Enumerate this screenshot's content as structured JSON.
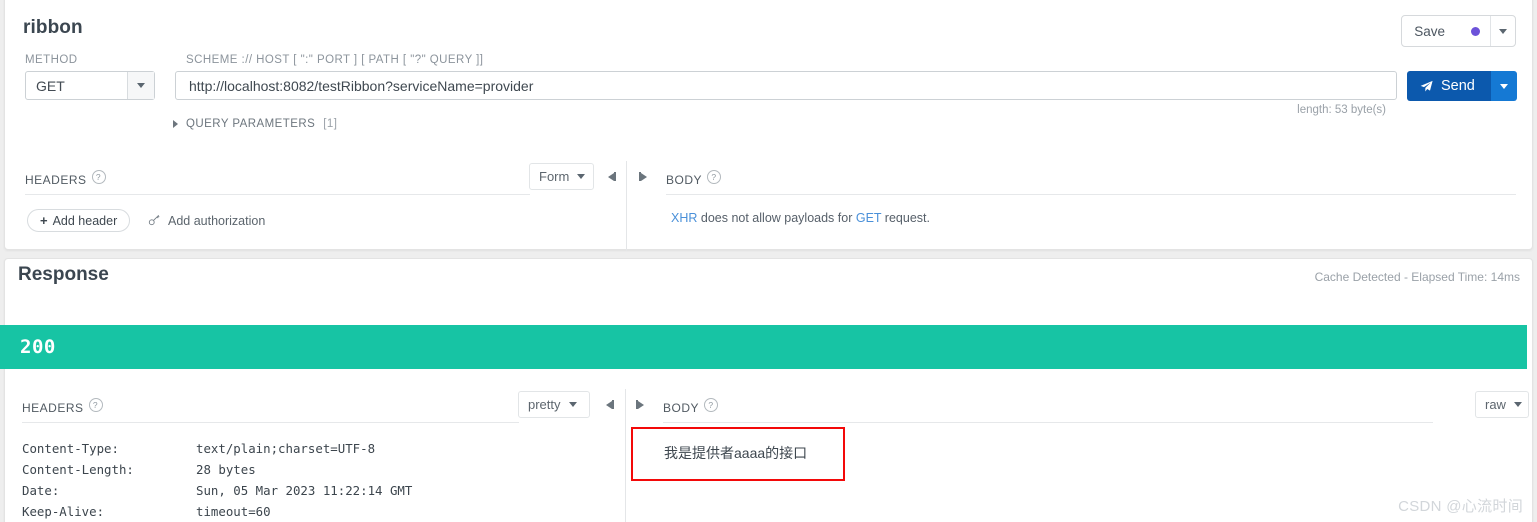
{
  "request": {
    "title": "ribbon",
    "save": {
      "label": "Save",
      "dot_color": "#6c52d9",
      "caret": "caret-down-icon"
    },
    "method": {
      "label": "METHOD",
      "value": "GET"
    },
    "url": {
      "label": "SCHEME :// HOST [ \":\" PORT ] [ PATH [ \"?\" QUERY ]]",
      "value": "http://localhost:8082/testRibbon?serviceName=provider"
    },
    "send": {
      "label": "Send",
      "icon": "paper-plane-icon",
      "color": "#0c59ad",
      "caret_color": "#1579d4"
    },
    "length_note": "length: 53 byte(s)",
    "query_parameters": {
      "label": "QUERY PARAMETERS",
      "count": "[1]"
    },
    "headers_panel": {
      "title": "HEADERS",
      "help": "?",
      "view_mode": "Form",
      "add_header_label": "Add header",
      "add_header_icon": "plus-icon",
      "add_authorization_label": "Add authorization",
      "add_authorization_icon": "key-icon"
    },
    "body_panel": {
      "title": "BODY",
      "help": "?",
      "message_prefix": "XHR",
      "message_middle": " does not allow payloads for ",
      "message_method": "GET",
      "message_suffix": " request."
    }
  },
  "response": {
    "title": "Response",
    "cache_note": "Cache Detected - Elapsed Time: 14ms",
    "status_code": "200",
    "status_color": "#17c4a4",
    "headers_panel": {
      "title": "HEADERS",
      "help": "?",
      "view_mode": "pretty",
      "rows": [
        {
          "key": "Content-Type:",
          "value": "text/plain;charset=UTF-8"
        },
        {
          "key": "Content-Length:",
          "value": "28 bytes"
        },
        {
          "key": "Date:",
          "value": "Sun, 05 Mar 2023 11:22:14 GMT"
        },
        {
          "key": "Keep-Alive:",
          "value": "timeout=60"
        }
      ]
    },
    "body_panel": {
      "title": "BODY",
      "help": "?",
      "view_mode": "raw",
      "content": "我是提供者aaaa的接口",
      "highlight_color": "#f30909"
    }
  },
  "watermark": "CSDN @心流时间"
}
